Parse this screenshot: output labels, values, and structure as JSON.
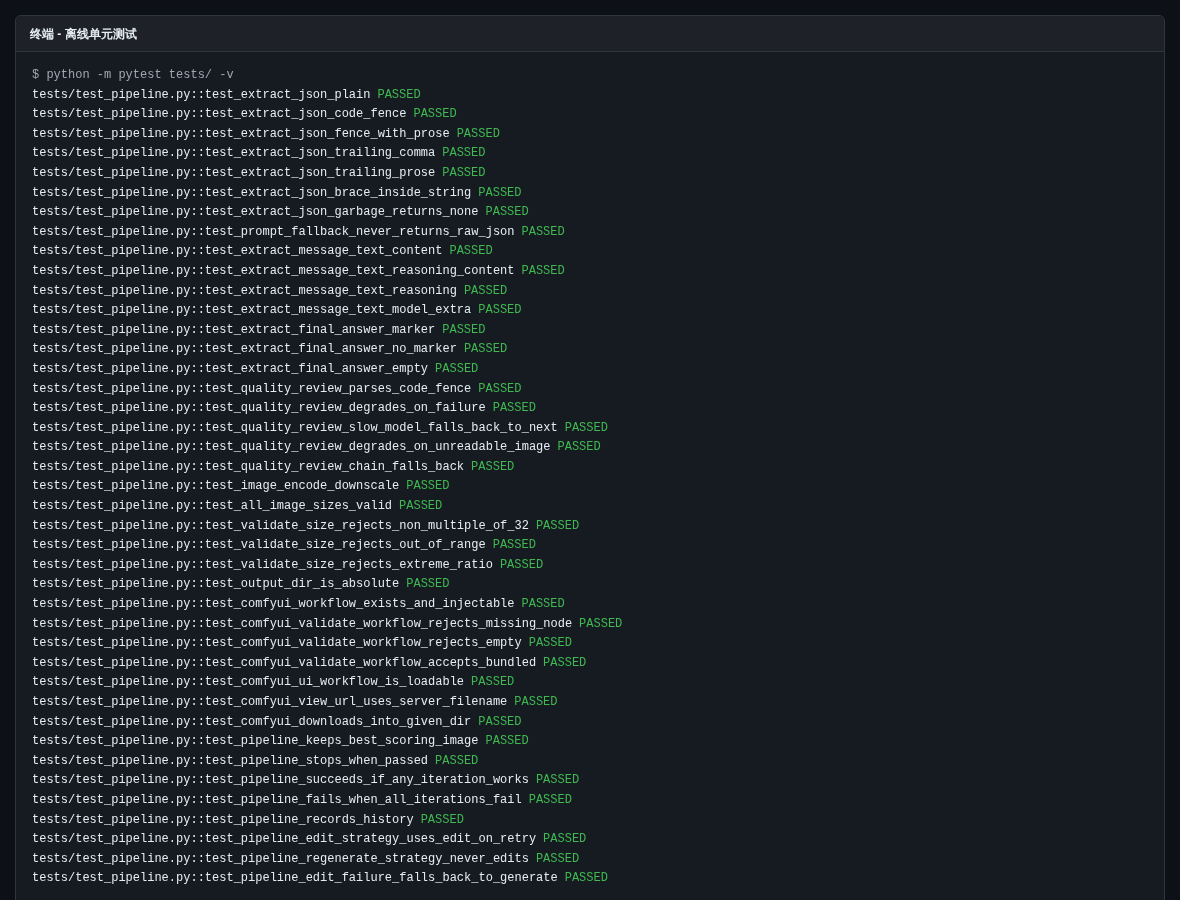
{
  "window": {
    "title": "终端 - 离线单元测试"
  },
  "command": "$ python -m pytest tests/ -v",
  "results": [
    {
      "test": "tests/test_pipeline.py::test_extract_json_plain",
      "result": "PASSED"
    },
    {
      "test": "tests/test_pipeline.py::test_extract_json_code_fence",
      "result": "PASSED"
    },
    {
      "test": "tests/test_pipeline.py::test_extract_json_fence_with_prose",
      "result": "PASSED"
    },
    {
      "test": "tests/test_pipeline.py::test_extract_json_trailing_comma",
      "result": "PASSED"
    },
    {
      "test": "tests/test_pipeline.py::test_extract_json_trailing_prose",
      "result": "PASSED"
    },
    {
      "test": "tests/test_pipeline.py::test_extract_json_brace_inside_string",
      "result": "PASSED"
    },
    {
      "test": "tests/test_pipeline.py::test_extract_json_garbage_returns_none",
      "result": "PASSED"
    },
    {
      "test": "tests/test_pipeline.py::test_prompt_fallback_never_returns_raw_json",
      "result": "PASSED"
    },
    {
      "test": "tests/test_pipeline.py::test_extract_message_text_content",
      "result": "PASSED"
    },
    {
      "test": "tests/test_pipeline.py::test_extract_message_text_reasoning_content",
      "result": "PASSED"
    },
    {
      "test": "tests/test_pipeline.py::test_extract_message_text_reasoning",
      "result": "PASSED"
    },
    {
      "test": "tests/test_pipeline.py::test_extract_message_text_model_extra",
      "result": "PASSED"
    },
    {
      "test": "tests/test_pipeline.py::test_extract_final_answer_marker",
      "result": "PASSED"
    },
    {
      "test": "tests/test_pipeline.py::test_extract_final_answer_no_marker",
      "result": "PASSED"
    },
    {
      "test": "tests/test_pipeline.py::test_extract_final_answer_empty",
      "result": "PASSED"
    },
    {
      "test": "tests/test_pipeline.py::test_quality_review_parses_code_fence",
      "result": "PASSED"
    },
    {
      "test": "tests/test_pipeline.py::test_quality_review_degrades_on_failure",
      "result": "PASSED"
    },
    {
      "test": "tests/test_pipeline.py::test_quality_review_slow_model_falls_back_to_next",
      "result": "PASSED"
    },
    {
      "test": "tests/test_pipeline.py::test_quality_review_degrades_on_unreadable_image",
      "result": "PASSED"
    },
    {
      "test": "tests/test_pipeline.py::test_quality_review_chain_falls_back",
      "result": "PASSED"
    },
    {
      "test": "tests/test_pipeline.py::test_image_encode_downscale",
      "result": "PASSED"
    },
    {
      "test": "tests/test_pipeline.py::test_all_image_sizes_valid",
      "result": "PASSED"
    },
    {
      "test": "tests/test_pipeline.py::test_validate_size_rejects_non_multiple_of_32",
      "result": "PASSED"
    },
    {
      "test": "tests/test_pipeline.py::test_validate_size_rejects_out_of_range",
      "result": "PASSED"
    },
    {
      "test": "tests/test_pipeline.py::test_validate_size_rejects_extreme_ratio",
      "result": "PASSED"
    },
    {
      "test": "tests/test_pipeline.py::test_output_dir_is_absolute",
      "result": "PASSED"
    },
    {
      "test": "tests/test_pipeline.py::test_comfyui_workflow_exists_and_injectable",
      "result": "PASSED"
    },
    {
      "test": "tests/test_pipeline.py::test_comfyui_validate_workflow_rejects_missing_node",
      "result": "PASSED"
    },
    {
      "test": "tests/test_pipeline.py::test_comfyui_validate_workflow_rejects_empty",
      "result": "PASSED"
    },
    {
      "test": "tests/test_pipeline.py::test_comfyui_validate_workflow_accepts_bundled",
      "result": "PASSED"
    },
    {
      "test": "tests/test_pipeline.py::test_comfyui_ui_workflow_is_loadable",
      "result": "PASSED"
    },
    {
      "test": "tests/test_pipeline.py::test_comfyui_view_url_uses_server_filename",
      "result": "PASSED"
    },
    {
      "test": "tests/test_pipeline.py::test_comfyui_downloads_into_given_dir",
      "result": "PASSED"
    },
    {
      "test": "tests/test_pipeline.py::test_pipeline_keeps_best_scoring_image",
      "result": "PASSED"
    },
    {
      "test": "tests/test_pipeline.py::test_pipeline_stops_when_passed",
      "result": "PASSED"
    },
    {
      "test": "tests/test_pipeline.py::test_pipeline_succeeds_if_any_iteration_works",
      "result": "PASSED"
    },
    {
      "test": "tests/test_pipeline.py::test_pipeline_fails_when_all_iterations_fail",
      "result": "PASSED"
    },
    {
      "test": "tests/test_pipeline.py::test_pipeline_records_history",
      "result": "PASSED"
    },
    {
      "test": "tests/test_pipeline.py::test_pipeline_edit_strategy_uses_edit_on_retry",
      "result": "PASSED"
    },
    {
      "test": "tests/test_pipeline.py::test_pipeline_regenerate_strategy_never_edits",
      "result": "PASSED"
    },
    {
      "test": "tests/test_pipeline.py::test_pipeline_edit_failure_falls_back_to_generate",
      "result": "PASSED"
    }
  ]
}
